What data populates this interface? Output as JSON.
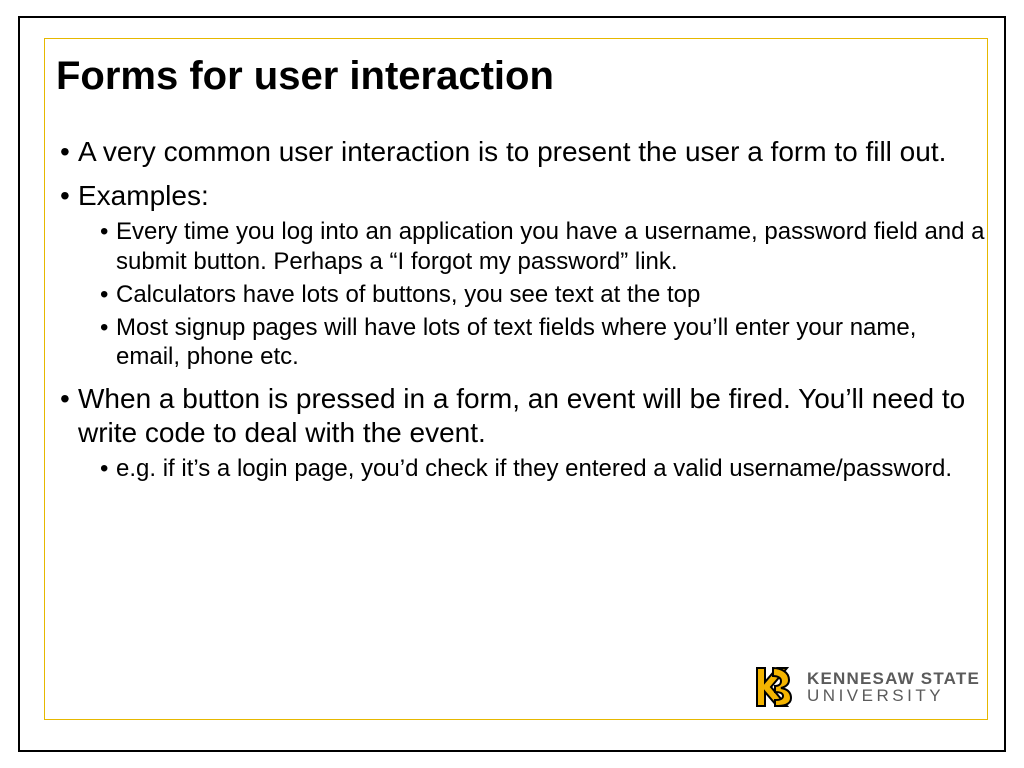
{
  "title": "Forms for user interaction",
  "bullets": {
    "b1": "A very common user interaction is to present the user a form to fill out.",
    "b2": "Examples:",
    "b2_sub": {
      "s1": "Every time you log into an application you have a username, password field and a submit button.  Perhaps a “I forgot my password” link.",
      "s2": "Calculators have lots of buttons, you see text at the top",
      "s3": "Most signup pages will have lots of text fields where you’ll enter your name, email, phone etc."
    },
    "b3": "When a button is pressed in a form, an event will be fired.  You’ll need to write code to deal with the event.",
    "b3_sub": {
      "s1": "e.g.  if it’s a login page, you’d check if they entered a valid username/password."
    }
  },
  "logo": {
    "line1": "KENNESAW STATE",
    "line2": "UNIVERSITY"
  }
}
